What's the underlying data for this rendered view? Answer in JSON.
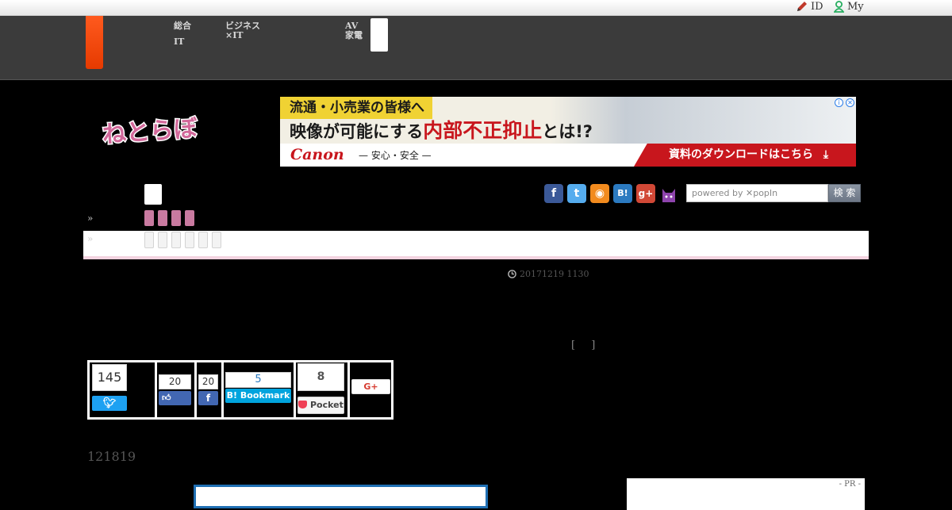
{
  "topbar": {
    "id_label": "ID",
    "my_label": "My"
  },
  "global_nav": {
    "items": [
      {
        "line1": "総合",
        "line2": "IT"
      },
      {
        "line1": "ビジネス",
        "line2": "×IT"
      },
      {
        "line1": "AV",
        "line2": "家電"
      }
    ]
  },
  "site": {
    "logo_text": "ねとらぼ"
  },
  "ad": {
    "line1": "流通・小売業の皆様へ",
    "line2_pre": "映像が可能にする",
    "line2_highlight": "内部不正抑止",
    "line2_post": "とは!?",
    "brand": "Canon",
    "tagline": "— 安心・安全 —",
    "cta": "資料のダウンロードはこちら",
    "info_icon": "info-icon",
    "close_icon": "close-icon"
  },
  "subnav": {
    "raquo": "»",
    "pink_count": 4,
    "grey_count": 6,
    "colors": {
      "pink": "#c97aa0",
      "grey": "#f3f3f3",
      "underline": "#f3d3e0"
    }
  },
  "social_icons": [
    {
      "name": "facebook-icon",
      "glyph": "f",
      "color": "#3b5998"
    },
    {
      "name": "twitter-icon",
      "glyph": "t",
      "color": "#55acee"
    },
    {
      "name": "rss-icon",
      "glyph": "◉",
      "color": "#f28b1e"
    },
    {
      "name": "hatena-bookmark-icon",
      "glyph": "B!",
      "color": "#2b7ac0"
    },
    {
      "name": "google-plus-icon",
      "glyph": "g+",
      "color": "#d14836"
    },
    {
      "name": "cat-mascot-icon",
      "glyph": "",
      "color": "#8e44ad"
    }
  ],
  "search": {
    "placeholder": "powered by ✕popIn",
    "button_label": "検 索"
  },
  "article": {
    "date": "20171219 1130",
    "bracket": "[ ]",
    "id_text": "121819"
  },
  "share": {
    "twitter": {
      "count": "145",
      "icon": "twitter-icon"
    },
    "facebook_like": {
      "count": "20",
      "icon": "thumbs-up-icon"
    },
    "facebook_share": {
      "count": "20",
      "icon": "facebook-icon"
    },
    "hatena": {
      "count": "5",
      "label": "Bookmark",
      "icon": "hatena-bookmark-icon"
    },
    "pocket": {
      "count": "8",
      "label": "Pocket",
      "icon": "pocket-icon"
    },
    "google_plus": {
      "label": "G+",
      "icon": "google-plus-icon"
    }
  },
  "sidebar": {
    "pr_label": "- PR -"
  }
}
